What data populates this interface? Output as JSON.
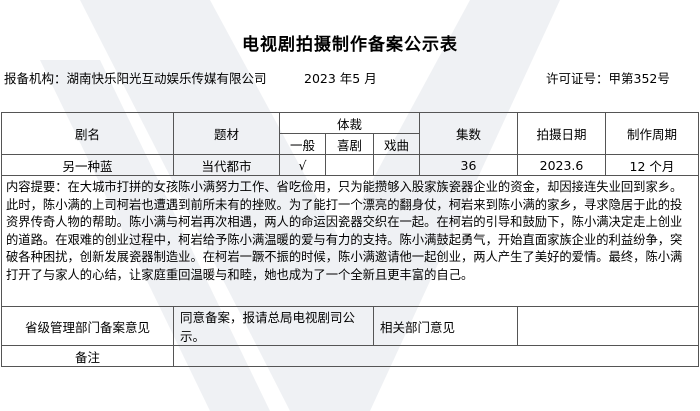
{
  "title": "电视剧拍摄制作备案公示表",
  "info": {
    "org_label": "报备机构：",
    "org_value": "湖南快乐阳光互动娱乐传媒有限公司",
    "date": "2023 年5 月",
    "license_label": "许可证号：",
    "license_value": "甲第352号"
  },
  "headers": {
    "name": "剧名",
    "theme": "题材",
    "genre": "体裁",
    "genre_general": "一般",
    "genre_comedy": "喜剧",
    "genre_opera": "戏曲",
    "episodes": "集数",
    "shoot_date": "拍摄日期",
    "cycle": "制作周期"
  },
  "row": {
    "name": "另一种蓝",
    "theme": "当代都市",
    "general": "√",
    "comedy": "",
    "opera": "",
    "episodes": "36",
    "shoot_date": "2023.6",
    "cycle": "12 个月"
  },
  "synopsis_label": "内容提要：",
  "synopsis": "在大城市打拼的女孩陈小满努力工作、省吃俭用，只为能攒够入股家族瓷器企业的资金，却因接连失业回到家乡。此时，陈小满的上司柯岩也遭遇到前所未有的挫败。为了能打一个漂亮的翻身仗，柯岩来到陈小满的家乡，寻求隐居于此的投资界传奇人物的帮助。陈小满与柯岩再次相遇，两人的命运因瓷器交织在一起。在柯岩的引导和鼓励下，陈小满决定走上创业的道路。在艰难的创业过程中，柯岩给予陈小满温暖的爱与有力的支持。陈小满鼓起勇气，开始直面家族企业的利益纷争，突破各种困扰，创新发展瓷器制造业。在柯岩一蹶不振的时候，陈小满邀请他一起创业，两人产生了美好的爱情。最终，陈小满打开了与家人的心结，让家庭重回温暖与和睦，她也成为了一个全新且更丰富的自己。",
  "opinion": {
    "provincial_label": "省级管理部门备案意见",
    "provincial_value": "同意备案，报请总局电视剧司公示。",
    "related_label": "相关部门意见",
    "related_value": ""
  },
  "note": {
    "label": "备注",
    "value": ""
  }
}
